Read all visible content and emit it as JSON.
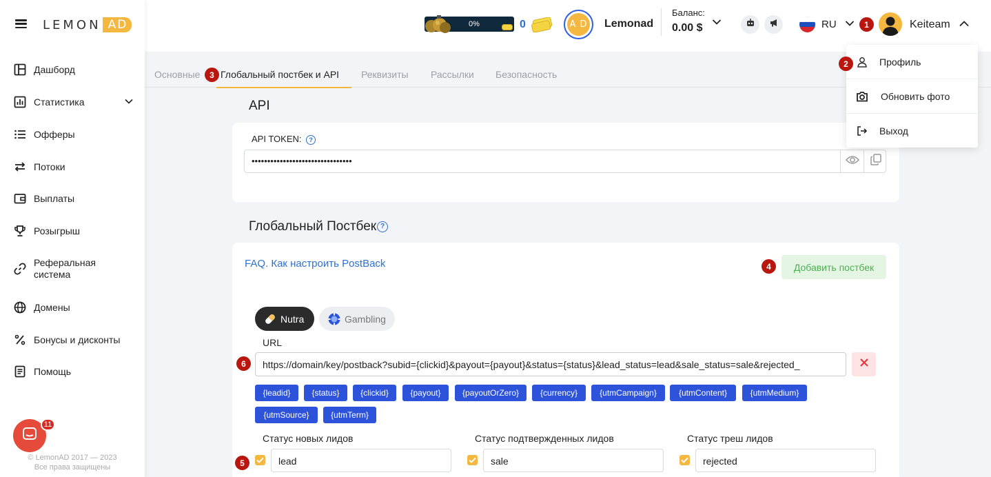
{
  "app": {
    "logo_left": "LEMON",
    "logo_right": "AD"
  },
  "sidebar": {
    "items": [
      {
        "label": "Дашборд",
        "icon": "dashboard-icon"
      },
      {
        "label": "Статистика",
        "icon": "statistics-icon",
        "has_submenu": true
      },
      {
        "label": "Офферы",
        "icon": "list-icon"
      },
      {
        "label": "Потоки",
        "icon": "arrows-icon"
      },
      {
        "label": "Выплаты",
        "icon": "wallet-icon"
      },
      {
        "label": "Розыгрыш",
        "icon": "trophy-icon"
      },
      {
        "label": "Реферальная система",
        "icon": "link-icon"
      },
      {
        "label": "Домены",
        "icon": "globe-icon"
      },
      {
        "label": "Бонусы и дисконты",
        "icon": "percent-icon"
      },
      {
        "label": "Помощь",
        "icon": "help-doc-icon"
      }
    ],
    "copyright_line1": "© LemonAD 2017 — 2023",
    "copyright_line2": "Все права защищены",
    "chat_badge": "11"
  },
  "header": {
    "gift_progress_label": "0%",
    "gift_progress": 0,
    "coins": "0",
    "avatar_initials": "A D",
    "brand": "Lemonad",
    "balance_label": "Баланс:",
    "balance_value": "0.00 $",
    "language": "RU",
    "username": "Keiteam"
  },
  "markers": [
    "1",
    "2",
    "3",
    "4",
    "5",
    "6"
  ],
  "tabs": [
    {
      "label": "Основные",
      "active": false
    },
    {
      "label": "Глобальный постбек и API",
      "active": true
    },
    {
      "label": "Реквизиты",
      "active": false
    },
    {
      "label": "Рассылки",
      "active": false
    },
    {
      "label": "Безопасность",
      "active": false
    }
  ],
  "api": {
    "title": "API",
    "token_label": "API TOKEN:",
    "token_value": "••••••••••••••••••••••••••••••••"
  },
  "postback": {
    "title": "Глобальный Постбек",
    "faq_link": "FAQ. Как настроить PostBack",
    "add_button": "Добавить постбек",
    "verticals": [
      {
        "label": "Nutra",
        "selected": true
      },
      {
        "label": "Gambling",
        "selected": false
      }
    ],
    "url_label": "URL",
    "url_value": "https://domain/key/postback?subid={clickid}&payout={payout}&status={status}&lead_status=lead&sale_status=sale&rejected_",
    "macros": [
      "{leadid}",
      "{status}",
      "{clickid}",
      "{payout}",
      "{payoutOrZero}",
      "{currency}",
      "{utmCampaign}",
      "{utmContent}",
      "{utmMedium}",
      "{utmSource}",
      "{utmTerm}"
    ],
    "statuses": [
      {
        "label": "Статус новых лидов",
        "value": "lead",
        "checked": true
      },
      {
        "label": "Статус подтвержденных лидов",
        "value": "sale",
        "checked": true
      },
      {
        "label": "Статус треш лидов",
        "value": "rejected",
        "checked": true
      }
    ]
  },
  "user_menu": {
    "items": [
      {
        "label": "Профиль",
        "icon": "user-icon"
      },
      {
        "label": "Обновить фото",
        "icon": "camera-icon"
      },
      {
        "label": "Выход",
        "icon": "logout-icon"
      }
    ]
  },
  "colors": {
    "accent": "#f4b740",
    "link": "#2d6fd3",
    "tag": "#2c53d9",
    "marker": "#b8160e"
  }
}
